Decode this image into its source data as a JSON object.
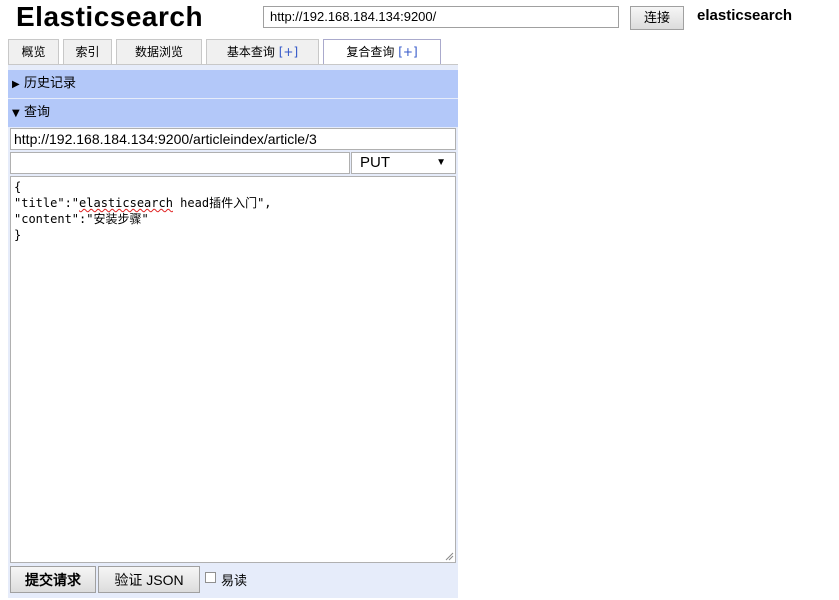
{
  "header": {
    "title": "Elasticsearch",
    "url": "http://192.168.184.134:9200/",
    "connect_label": "连接",
    "cluster_name": "elasticsearch"
  },
  "tabs": [
    {
      "label": "概览",
      "plus": ""
    },
    {
      "label": "索引",
      "plus": ""
    },
    {
      "label": "数据浏览",
      "plus": ""
    },
    {
      "label": "基本查询 ",
      "plus": "[+]"
    },
    {
      "label": "复合查询 ",
      "plus": "[+]",
      "active": true
    }
  ],
  "history": {
    "label": "历史记录",
    "expanded": false
  },
  "query": {
    "label": "查询",
    "expanded": true,
    "path": "http://192.168.184.134:9200/articleindex/article/3",
    "extra_path": "",
    "method": "PUT",
    "body_lines": {
      "l1": "{",
      "l2_pre": "\"title\":\"",
      "l2_squiggle": "elasticsearch",
      "l2_post": " head插件入门\",",
      "l3": "\"content\":\"安装步骤\"",
      "l4": "}"
    },
    "submit_label": "提交请求",
    "validate_label": "验证 JSON",
    "pretty_label": "易读",
    "pretty_checked": false
  }
}
